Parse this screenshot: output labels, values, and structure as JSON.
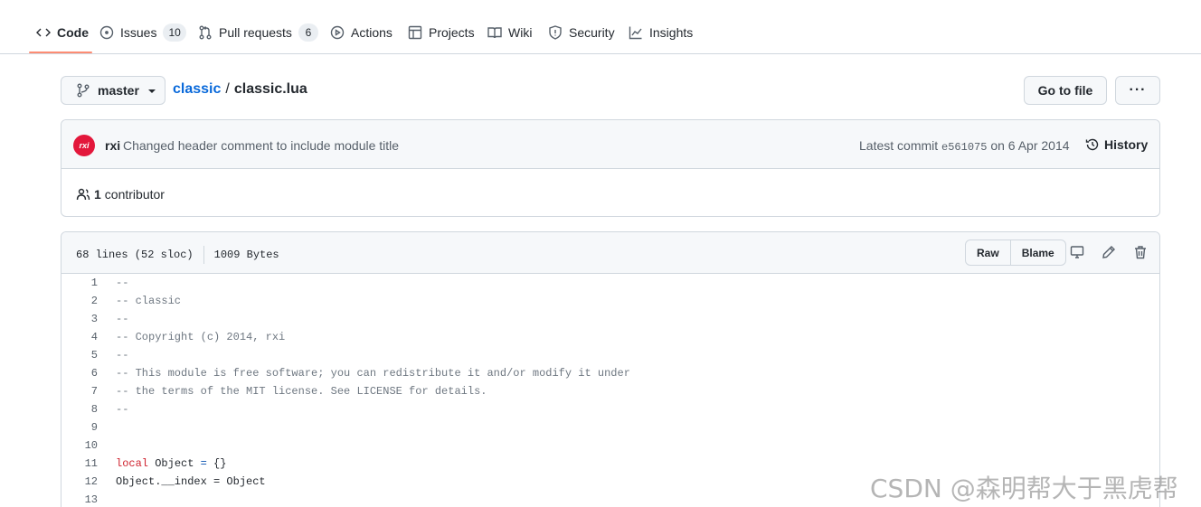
{
  "nav": {
    "tabs": [
      {
        "label": "Code",
        "icon": "code-icon",
        "active": true
      },
      {
        "label": "Issues",
        "icon": "issue-icon",
        "count": "10"
      },
      {
        "label": "Pull requests",
        "icon": "pull-request-icon",
        "count": "6"
      },
      {
        "label": "Actions",
        "icon": "play-icon"
      },
      {
        "label": "Projects",
        "icon": "table-icon"
      },
      {
        "label": "Wiki",
        "icon": "book-icon"
      },
      {
        "label": "Security",
        "icon": "shield-icon"
      },
      {
        "label": "Insights",
        "icon": "graph-icon"
      }
    ]
  },
  "branch": {
    "name": "master"
  },
  "breadcrumb": {
    "repo": "classic",
    "separator": "/",
    "file": "classic.lua"
  },
  "actions": {
    "goto_file": "Go to file",
    "more": "···"
  },
  "commit": {
    "avatar_text": "rxi",
    "author": "rxi",
    "message": "Changed header comment to include module title",
    "latest_label": "Latest commit",
    "sha": "e561075",
    "date": "on 6 Apr 2014",
    "history_label": "History"
  },
  "contributors": {
    "count": "1",
    "label": "contributor"
  },
  "file": {
    "lines_info": "68 lines (52 sloc)",
    "size": "1009 Bytes",
    "raw_label": "Raw",
    "blame_label": "Blame"
  },
  "code_lines": [
    {
      "n": "1",
      "text": "--"
    },
    {
      "n": "2",
      "text": "-- classic"
    },
    {
      "n": "3",
      "text": "--"
    },
    {
      "n": "4",
      "text": "-- Copyright (c) 2014, rxi"
    },
    {
      "n": "5",
      "text": "--"
    },
    {
      "n": "6",
      "text": "-- This module is free software; you can redistribute it and/or modify it under"
    },
    {
      "n": "7",
      "text": "-- the terms of the MIT license. See LICENSE for details."
    },
    {
      "n": "8",
      "text": "--"
    },
    {
      "n": "9",
      "text": ""
    },
    {
      "n": "10",
      "text": ""
    },
    {
      "n": "11",
      "kw": "local",
      "rest": " Object ",
      "op": "=",
      "tail": " {}"
    },
    {
      "n": "12",
      "text": "Object.__index = Object",
      "plain": true
    },
    {
      "n": "13",
      "text": ""
    }
  ],
  "watermark": "CSDN @森明帮大于黑虎帮",
  "colors": {
    "accent_underline": "#fd8c73",
    "link": "#0969da",
    "keyword": "#cf222e",
    "avatar_bg": "#e3173b"
  }
}
